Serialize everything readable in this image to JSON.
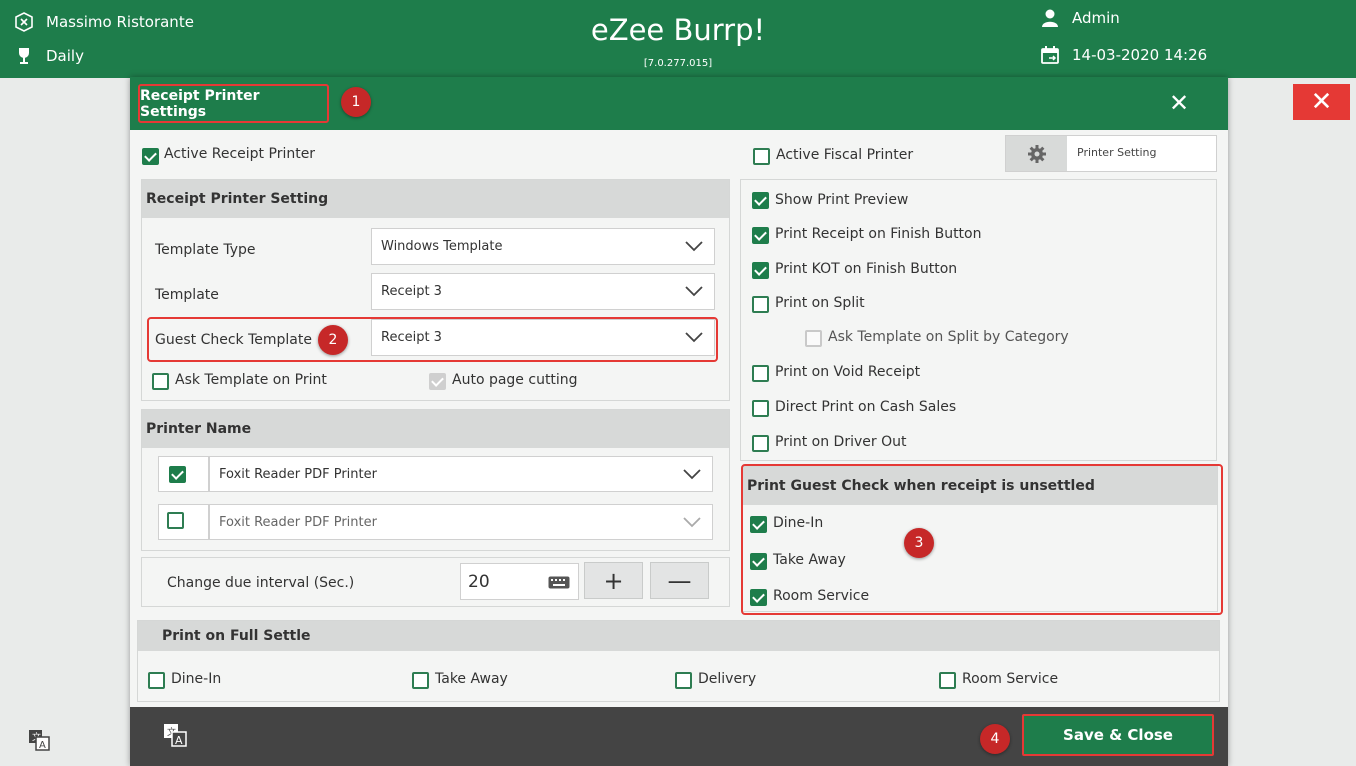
{
  "header": {
    "restaurant": "Massimo Ristorante",
    "mode": "Daily",
    "app_title": "eZee Burrp!",
    "version": "[7.0.277.015]",
    "user": "Admin",
    "datetime": "14-03-2020 14:26"
  },
  "dialog": {
    "title": "Receipt Printer Settings",
    "badges": [
      "1",
      "2",
      "3",
      "4"
    ],
    "left": {
      "active_receipt_printer": {
        "label": "Active Receipt Printer",
        "checked": true
      },
      "receipt_printer_setting": {
        "heading": "Receipt Printer Setting",
        "template_type": {
          "label": "Template Type",
          "value": "Windows Template"
        },
        "template": {
          "label": "Template",
          "value": "Receipt 3"
        },
        "guest_check_template": {
          "label": "Guest Check Template",
          "value": "Receipt 3"
        },
        "ask_template_on_print": {
          "label": "Ask Template on Print",
          "checked": false
        },
        "auto_page_cutting": {
          "label": "Auto page cutting",
          "checked": true,
          "disabled": true
        }
      },
      "printer_name": {
        "heading": "Printer Name",
        "printers": [
          {
            "name": "Foxit Reader PDF Printer",
            "checked": true
          },
          {
            "name": "Foxit Reader PDF Printer",
            "checked": false
          }
        ]
      },
      "change_due": {
        "label": "Change due interval (Sec.)",
        "value": "20",
        "plus": "+",
        "minus": "—"
      }
    },
    "right": {
      "active_fiscal_printer": {
        "label": "Active Fiscal Printer",
        "checked": false
      },
      "printer_setting_button": "Printer Setting",
      "options": [
        {
          "label": "Show Print Preview",
          "checked": true
        },
        {
          "label": "Print Receipt on Finish Button",
          "checked": true
        },
        {
          "label": "Print KOT on Finish Button",
          "checked": true
        },
        {
          "label": "Print on Split",
          "checked": false
        },
        {
          "label": "Ask Template on Split by Category",
          "checked": false
        },
        {
          "label": "Print on Void Receipt",
          "checked": false
        },
        {
          "label": "Direct Print on Cash Sales",
          "checked": false
        },
        {
          "label": "Print on Driver Out",
          "checked": false
        }
      ],
      "guest_check_unsettled": {
        "heading": "Print Guest Check when receipt is unsettled",
        "items": [
          {
            "label": "Dine-In",
            "checked": true
          },
          {
            "label": "Take Away",
            "checked": true
          },
          {
            "label": "Room Service",
            "checked": true
          }
        ]
      }
    },
    "full_settle": {
      "heading": "Print on Full Settle",
      "items": [
        {
          "label": "Dine-In",
          "checked": false
        },
        {
          "label": "Take Away",
          "checked": false
        },
        {
          "label": "Delivery",
          "checked": false
        },
        {
          "label": "Room Service",
          "checked": false
        }
      ]
    },
    "save_close": "Save & Close"
  },
  "colors": {
    "brand_green": "#1e7d4b",
    "highlight_red": "#e53935",
    "footer_dark": "#444444"
  }
}
